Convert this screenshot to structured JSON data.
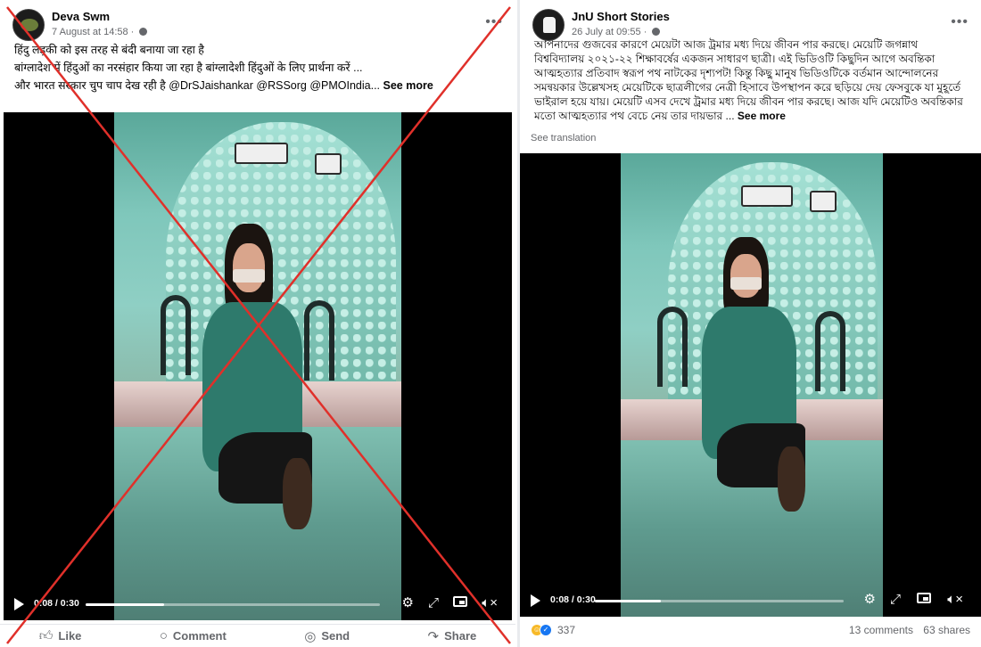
{
  "left_post": {
    "author": "Deva Swm",
    "date": "7 August at 14:58 ·",
    "more_label": "•••",
    "text_lines": [
      "हिंदु लड़की को इस तरह से बंदी बनाया जा रहा है",
      "बांग्लादेश में हिंदुओं का नरसंहार किया जा रहा है बांग्लादेशी हिंदुओं के लिए प्रार्थना करें ...",
      "और भारत सरकार चुप चाप देख रही है  @DrSJaishankar @RSSorg @PMOIndia..."
    ],
    "see_more": "See more",
    "video": {
      "time": "0:08 / 0:30",
      "progress": 0.267
    },
    "actions": {
      "like": "Like",
      "comment": "Comment",
      "send": "Send",
      "share": "Share"
    },
    "crossed_out": true,
    "cross_color": "#e0302a"
  },
  "right_post": {
    "author": "JnU Short Stories",
    "date": "26 July at 09:55 ·",
    "more_label": "•••",
    "text": "আপনাদের গুজবের কারণে মেয়েটা আজ ট্রমার মধ্য দিয়ে জীবন পার করছে। মেয়েটি জগন্নাথ বিশ্ববিদ্যালয় ২০২১-২২ শিক্ষাবর্ষের একজন সাধারণ ছাত্রী। এই ভিডিওটি কিছুদিন আগে অবন্তিকা আত্মহত্যার প্রতিবাদ স্বরূপ পথ নাটকের দৃশ্যপট! কিন্তু কিছু মানুষ ভিডিওটিকে বর্তমান আন্দোলনের সমন্বয়কার উল্লেখসহ মেয়েটিকে ছাত্রলীগের নেত্রী হিসাবে উপস্থাপন করে ছড়িয়ে দেয় ফেসবুকে যা মুহূর্তে ভাইরাল হয়ে যায়। মেয়েটি এসব দেখে ট্রমার মধ্য দিয়ে জীবন পার করছে। আজ যদি মেয়েটিও অবন্তিকার মতো আত্মহত্যার পথ বেচে নেয় তার দায়ভার ...",
    "see_more": "See more",
    "see_translation": "See translation",
    "video": {
      "time": "0:08 / 0:30",
      "progress": 0.267
    },
    "stats": {
      "reactions": "337",
      "comments": "13 comments",
      "shares": "63 shares"
    }
  },
  "icons": {
    "play": "play-icon",
    "settings": "gear-icon",
    "fullscreen": "expand-icon",
    "pip": "pip-icon",
    "volume": "volume-muted-icon"
  },
  "glyphs": {
    "gear": "⚙",
    "expand": "⤢",
    "volume": "🔈︎×",
    "like": "👍︎",
    "comment": "○",
    "send": "◎",
    "share": "↷",
    "haha": "☺",
    "like_react": "✓"
  }
}
